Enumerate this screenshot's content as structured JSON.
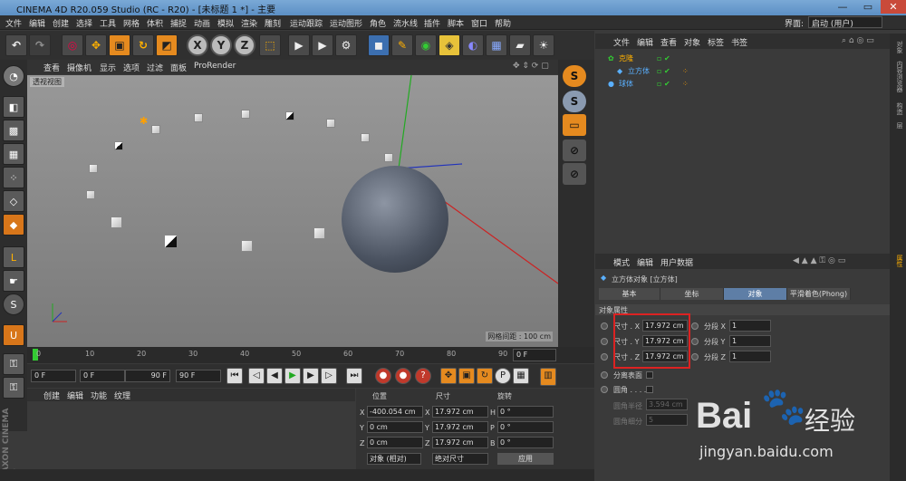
{
  "window": {
    "title": "CINEMA 4D R20.059 Studio (RC - R20) - [未标题 1 *] - 主要",
    "layout_label": "界面:",
    "layout_value": "启动 (用户)"
  },
  "menu": [
    "文件",
    "编辑",
    "创建",
    "选择",
    "工具",
    "网格",
    "体积",
    "捕捉",
    "动画",
    "模拟",
    "渲染",
    "雕刻",
    "运动跟踪",
    "运动图形",
    "角色",
    "流水线",
    "插件",
    "脚本",
    "窗口",
    "帮助"
  ],
  "viewport": {
    "menu": [
      "查看",
      "摄像机",
      "显示",
      "选项",
      "过滤",
      "面板",
      "ProRender"
    ],
    "label": "透视视图",
    "grid": "网格间距 : 100 cm"
  },
  "timeline": {
    "ticks": [
      "0",
      "10",
      "20",
      "30",
      "40",
      "50",
      "60",
      "70",
      "80",
      "90"
    ],
    "frame_end": "0 F"
  },
  "transport": {
    "start": "0 F",
    "range_start": "0 F",
    "range_end": "90 F",
    "end": "90 F"
  },
  "materials": {
    "menu": [
      "创建",
      "编辑",
      "功能",
      "纹理"
    ]
  },
  "coords": {
    "headers": [
      "位置",
      "尺寸",
      "旋转"
    ],
    "rows": [
      {
        "axis": "X",
        "pos": "-400.054 cm",
        "size": "17.972 cm",
        "rlabel": "H",
        "rot": "0 °"
      },
      {
        "axis": "Y",
        "pos": "0 cm",
        "size": "17.972 cm",
        "rlabel": "P",
        "rot": "0 °"
      },
      {
        "axis": "Z",
        "pos": "0 cm",
        "size": "17.972 cm",
        "rlabel": "B",
        "rot": "0 °"
      }
    ],
    "mode": "对象 (相对)",
    "sizemode": "绝对尺寸",
    "apply": "应用"
  },
  "objects": {
    "menu": [
      "文件",
      "编辑",
      "查看",
      "对象",
      "标签",
      "书签"
    ],
    "items": [
      {
        "name": "克隆"
      },
      {
        "name": "立方体"
      },
      {
        "name": "球体"
      }
    ]
  },
  "attributes": {
    "menu": [
      "模式",
      "编辑",
      "用户数据"
    ],
    "title": "立方体对象 [立方体]",
    "tabs": [
      "基本",
      "坐标",
      "对象",
      "平滑着色(Phong)"
    ],
    "section": "对象属性",
    "size": [
      {
        "label": "尺寸 . X",
        "value": "17.972 cm"
      },
      {
        "label": "尺寸 . Y",
        "value": "17.972 cm"
      },
      {
        "label": "尺寸 . Z",
        "value": "17.972 cm"
      }
    ],
    "seg": [
      {
        "label": "分段 X",
        "value": "1"
      },
      {
        "label": "分段 Y",
        "value": "1"
      },
      {
        "label": "分段 Z",
        "value": "1"
      }
    ],
    "sep": "分离表面",
    "fillet": "圆角 . . . .",
    "fillet_r": "圆角半径",
    "fillet_r_val": "3.594 cm",
    "fillet_s": "圆角细分",
    "fillet_s_val": "5"
  },
  "sidebar": [
    "对象",
    "内容浏览器",
    "构造",
    "层",
    "属性"
  ],
  "watermark": {
    "brand": "Bai",
    "suffix": "经验",
    "url": "jingyan.baidu.com"
  },
  "brand": [
    "MAXON",
    "CINEMA 4D"
  ]
}
